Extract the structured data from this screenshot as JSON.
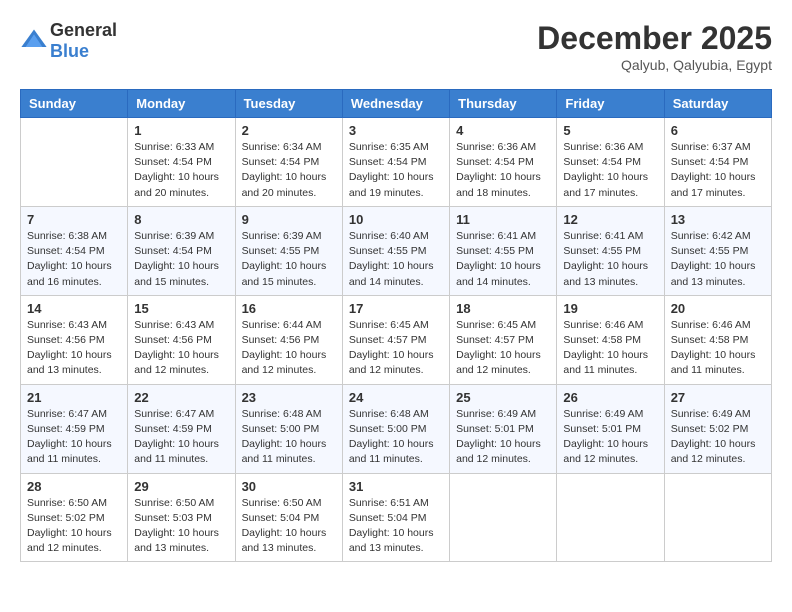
{
  "header": {
    "logo_line1": "General",
    "logo_line2": "Blue",
    "month": "December 2025",
    "location": "Qalyub, Qalyubia, Egypt"
  },
  "weekdays": [
    "Sunday",
    "Monday",
    "Tuesday",
    "Wednesday",
    "Thursday",
    "Friday",
    "Saturday"
  ],
  "weeks": [
    [
      {
        "day": "",
        "sunrise": "",
        "sunset": "",
        "daylight": ""
      },
      {
        "day": "1",
        "sunrise": "Sunrise: 6:33 AM",
        "sunset": "Sunset: 4:54 PM",
        "daylight": "Daylight: 10 hours and 20 minutes."
      },
      {
        "day": "2",
        "sunrise": "Sunrise: 6:34 AM",
        "sunset": "Sunset: 4:54 PM",
        "daylight": "Daylight: 10 hours and 20 minutes."
      },
      {
        "day": "3",
        "sunrise": "Sunrise: 6:35 AM",
        "sunset": "Sunset: 4:54 PM",
        "daylight": "Daylight: 10 hours and 19 minutes."
      },
      {
        "day": "4",
        "sunrise": "Sunrise: 6:36 AM",
        "sunset": "Sunset: 4:54 PM",
        "daylight": "Daylight: 10 hours and 18 minutes."
      },
      {
        "day": "5",
        "sunrise": "Sunrise: 6:36 AM",
        "sunset": "Sunset: 4:54 PM",
        "daylight": "Daylight: 10 hours and 17 minutes."
      },
      {
        "day": "6",
        "sunrise": "Sunrise: 6:37 AM",
        "sunset": "Sunset: 4:54 PM",
        "daylight": "Daylight: 10 hours and 17 minutes."
      }
    ],
    [
      {
        "day": "7",
        "sunrise": "Sunrise: 6:38 AM",
        "sunset": "Sunset: 4:54 PM",
        "daylight": "Daylight: 10 hours and 16 minutes."
      },
      {
        "day": "8",
        "sunrise": "Sunrise: 6:39 AM",
        "sunset": "Sunset: 4:54 PM",
        "daylight": "Daylight: 10 hours and 15 minutes."
      },
      {
        "day": "9",
        "sunrise": "Sunrise: 6:39 AM",
        "sunset": "Sunset: 4:55 PM",
        "daylight": "Daylight: 10 hours and 15 minutes."
      },
      {
        "day": "10",
        "sunrise": "Sunrise: 6:40 AM",
        "sunset": "Sunset: 4:55 PM",
        "daylight": "Daylight: 10 hours and 14 minutes."
      },
      {
        "day": "11",
        "sunrise": "Sunrise: 6:41 AM",
        "sunset": "Sunset: 4:55 PM",
        "daylight": "Daylight: 10 hours and 14 minutes."
      },
      {
        "day": "12",
        "sunrise": "Sunrise: 6:41 AM",
        "sunset": "Sunset: 4:55 PM",
        "daylight": "Daylight: 10 hours and 13 minutes."
      },
      {
        "day": "13",
        "sunrise": "Sunrise: 6:42 AM",
        "sunset": "Sunset: 4:55 PM",
        "daylight": "Daylight: 10 hours and 13 minutes."
      }
    ],
    [
      {
        "day": "14",
        "sunrise": "Sunrise: 6:43 AM",
        "sunset": "Sunset: 4:56 PM",
        "daylight": "Daylight: 10 hours and 13 minutes."
      },
      {
        "day": "15",
        "sunrise": "Sunrise: 6:43 AM",
        "sunset": "Sunset: 4:56 PM",
        "daylight": "Daylight: 10 hours and 12 minutes."
      },
      {
        "day": "16",
        "sunrise": "Sunrise: 6:44 AM",
        "sunset": "Sunset: 4:56 PM",
        "daylight": "Daylight: 10 hours and 12 minutes."
      },
      {
        "day": "17",
        "sunrise": "Sunrise: 6:45 AM",
        "sunset": "Sunset: 4:57 PM",
        "daylight": "Daylight: 10 hours and 12 minutes."
      },
      {
        "day": "18",
        "sunrise": "Sunrise: 6:45 AM",
        "sunset": "Sunset: 4:57 PM",
        "daylight": "Daylight: 10 hours and 12 minutes."
      },
      {
        "day": "19",
        "sunrise": "Sunrise: 6:46 AM",
        "sunset": "Sunset: 4:58 PM",
        "daylight": "Daylight: 10 hours and 11 minutes."
      },
      {
        "day": "20",
        "sunrise": "Sunrise: 6:46 AM",
        "sunset": "Sunset: 4:58 PM",
        "daylight": "Daylight: 10 hours and 11 minutes."
      }
    ],
    [
      {
        "day": "21",
        "sunrise": "Sunrise: 6:47 AM",
        "sunset": "Sunset: 4:59 PM",
        "daylight": "Daylight: 10 hours and 11 minutes."
      },
      {
        "day": "22",
        "sunrise": "Sunrise: 6:47 AM",
        "sunset": "Sunset: 4:59 PM",
        "daylight": "Daylight: 10 hours and 11 minutes."
      },
      {
        "day": "23",
        "sunrise": "Sunrise: 6:48 AM",
        "sunset": "Sunset: 5:00 PM",
        "daylight": "Daylight: 10 hours and 11 minutes."
      },
      {
        "day": "24",
        "sunrise": "Sunrise: 6:48 AM",
        "sunset": "Sunset: 5:00 PM",
        "daylight": "Daylight: 10 hours and 11 minutes."
      },
      {
        "day": "25",
        "sunrise": "Sunrise: 6:49 AM",
        "sunset": "Sunset: 5:01 PM",
        "daylight": "Daylight: 10 hours and 12 minutes."
      },
      {
        "day": "26",
        "sunrise": "Sunrise: 6:49 AM",
        "sunset": "Sunset: 5:01 PM",
        "daylight": "Daylight: 10 hours and 12 minutes."
      },
      {
        "day": "27",
        "sunrise": "Sunrise: 6:49 AM",
        "sunset": "Sunset: 5:02 PM",
        "daylight": "Daylight: 10 hours and 12 minutes."
      }
    ],
    [
      {
        "day": "28",
        "sunrise": "Sunrise: 6:50 AM",
        "sunset": "Sunset: 5:02 PM",
        "daylight": "Daylight: 10 hours and 12 minutes."
      },
      {
        "day": "29",
        "sunrise": "Sunrise: 6:50 AM",
        "sunset": "Sunset: 5:03 PM",
        "daylight": "Daylight: 10 hours and 13 minutes."
      },
      {
        "day": "30",
        "sunrise": "Sunrise: 6:50 AM",
        "sunset": "Sunset: 5:04 PM",
        "daylight": "Daylight: 10 hours and 13 minutes."
      },
      {
        "day": "31",
        "sunrise": "Sunrise: 6:51 AM",
        "sunset": "Sunset: 5:04 PM",
        "daylight": "Daylight: 10 hours and 13 minutes."
      },
      {
        "day": "",
        "sunrise": "",
        "sunset": "",
        "daylight": ""
      },
      {
        "day": "",
        "sunrise": "",
        "sunset": "",
        "daylight": ""
      },
      {
        "day": "",
        "sunrise": "",
        "sunset": "",
        "daylight": ""
      }
    ]
  ]
}
